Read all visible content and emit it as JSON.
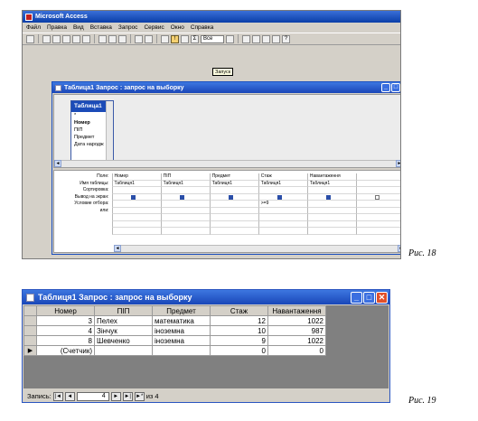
{
  "fig18": {
    "app_title": "Microsoft Access",
    "menu": [
      "Файл",
      "Правка",
      "Вид",
      "Вставка",
      "Запрос",
      "Сервис",
      "Окно",
      "Справка"
    ],
    "toolbar_combo": "Все",
    "tooltip": "Запуск",
    "query_title": "Таблица1 Запрос : запрос на выборку",
    "table_box": {
      "name": "Таблица1",
      "fields": [
        "*",
        "Номер",
        "ПІП",
        "Предмет",
        "Дата народж"
      ]
    },
    "grid": {
      "row_labels": [
        "Поле:",
        "Имя таблицы:",
        "Сортировка:",
        "Вывод на экран:",
        "Условие отбора:",
        "или:"
      ],
      "columns": [
        {
          "field": "Номер",
          "table": "Таблиця1",
          "criteria": ""
        },
        {
          "field": "ПІП",
          "table": "Таблиця1",
          "criteria": ""
        },
        {
          "field": "Предмет",
          "table": "Таблиця1",
          "criteria": ""
        },
        {
          "field": "Стаж",
          "table": "Таблиця1",
          "criteria": ">=9"
        },
        {
          "field": "Навантаження",
          "table": "Таблиця1",
          "criteria": ""
        }
      ]
    },
    "caption": "Рис. 18"
  },
  "fig19": {
    "title": "Таблиця1 Запрос : запрос на выборку",
    "headers": [
      "Номер",
      "ПІП",
      "Предмет",
      "Стаж",
      "Навантаження"
    ],
    "rows": [
      {
        "num": "3",
        "name": "Пелех",
        "subject": "математика",
        "exp": "12",
        "load": "1022"
      },
      {
        "num": "4",
        "name": "Зінчук",
        "subject": "іноземна",
        "exp": "10",
        "load": "987"
      },
      {
        "num": "8",
        "name": "Шевченко",
        "subject": "іноземна",
        "exp": "9",
        "load": "1022"
      }
    ],
    "new_row": {
      "num": "(Счетчик)",
      "exp": "0",
      "load": "0"
    },
    "nav": {
      "label": "Запись:",
      "current": "4",
      "total_text": "из 4"
    },
    "caption": "Рис. 19"
  }
}
